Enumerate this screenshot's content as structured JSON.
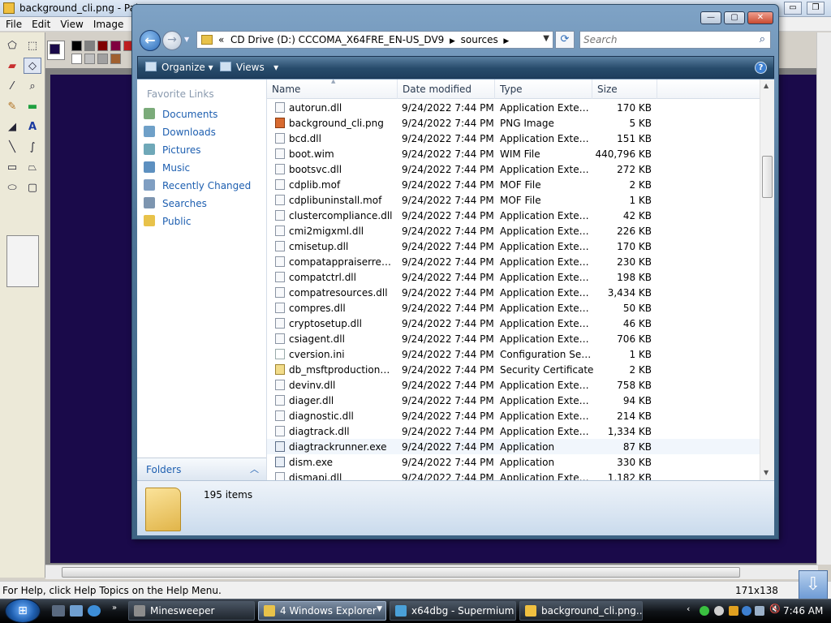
{
  "paint": {
    "title": "background_cli.png - Paint",
    "menu": [
      "File",
      "Edit",
      "View",
      "Image"
    ],
    "status_help": "For Help, click Help Topics on the Help Menu.",
    "status_coords": "171x138"
  },
  "explorer": {
    "caption_buttons": {
      "minimize": "—",
      "maximize": "▢",
      "close": "✕"
    },
    "address": {
      "prefix": "«",
      "crumbs": [
        "CD Drive (D:) CCCOMA_X64FRE_EN-US_DV9",
        "sources"
      ]
    },
    "search_placeholder": "Search",
    "commands": {
      "organize": "Organize",
      "views": "Views"
    },
    "favorite_links_header": "Favorite Links",
    "favorite_links": [
      "Documents",
      "Downloads",
      "Pictures",
      "Music",
      "Recently Changed",
      "Searches",
      "Public"
    ],
    "folders_label": "Folders",
    "columns": {
      "name": "Name",
      "date": "Date modified",
      "type": "Type",
      "size": "Size"
    },
    "files": [
      {
        "name": "autorun.dll",
        "date": "9/24/2022 7:44 PM",
        "type": "Application Extens...",
        "size": "170 KB",
        "icon": "dll"
      },
      {
        "name": "background_cli.png",
        "date": "9/24/2022 7:44 PM",
        "type": "PNG Image",
        "size": "5 KB",
        "icon": "png"
      },
      {
        "name": "bcd.dll",
        "date": "9/24/2022 7:44 PM",
        "type": "Application Extens...",
        "size": "151 KB",
        "icon": "dll"
      },
      {
        "name": "boot.wim",
        "date": "9/24/2022 7:44 PM",
        "type": "WIM File",
        "size": "440,796 KB",
        "icon": "file"
      },
      {
        "name": "bootsvc.dll",
        "date": "9/24/2022 7:44 PM",
        "type": "Application Extens...",
        "size": "272 KB",
        "icon": "dll"
      },
      {
        "name": "cdplib.mof",
        "date": "9/24/2022 7:44 PM",
        "type": "MOF File",
        "size": "2 KB",
        "icon": "file"
      },
      {
        "name": "cdplibuninstall.mof",
        "date": "9/24/2022 7:44 PM",
        "type": "MOF File",
        "size": "1 KB",
        "icon": "file"
      },
      {
        "name": "clustercompliance.dll",
        "date": "9/24/2022 7:44 PM",
        "type": "Application Extens...",
        "size": "42 KB",
        "icon": "dll"
      },
      {
        "name": "cmi2migxml.dll",
        "date": "9/24/2022 7:44 PM",
        "type": "Application Extens...",
        "size": "226 KB",
        "icon": "dll"
      },
      {
        "name": "cmisetup.dll",
        "date": "9/24/2022 7:44 PM",
        "type": "Application Extens...",
        "size": "170 KB",
        "icon": "dll"
      },
      {
        "name": "compatappraiserresou...",
        "date": "9/24/2022 7:44 PM",
        "type": "Application Extens...",
        "size": "230 KB",
        "icon": "dll"
      },
      {
        "name": "compatctrl.dll",
        "date": "9/24/2022 7:44 PM",
        "type": "Application Extens...",
        "size": "198 KB",
        "icon": "dll"
      },
      {
        "name": "compatresources.dll",
        "date": "9/24/2022 7:44 PM",
        "type": "Application Extens...",
        "size": "3,434 KB",
        "icon": "dll"
      },
      {
        "name": "compres.dll",
        "date": "9/24/2022 7:44 PM",
        "type": "Application Extens...",
        "size": "50 KB",
        "icon": "dll"
      },
      {
        "name": "cryptosetup.dll",
        "date": "9/24/2022 7:44 PM",
        "type": "Application Extens...",
        "size": "46 KB",
        "icon": "dll"
      },
      {
        "name": "csiagent.dll",
        "date": "9/24/2022 7:44 PM",
        "type": "Application Extens...",
        "size": "706 KB",
        "icon": "dll"
      },
      {
        "name": "cversion.ini",
        "date": "9/24/2022 7:44 PM",
        "type": "Configuration Sett...",
        "size": "1 KB",
        "icon": "ini"
      },
      {
        "name": "db_msftproductionwin...",
        "date": "9/24/2022 7:44 PM",
        "type": "Security Certificate",
        "size": "2 KB",
        "icon": "cert"
      },
      {
        "name": "devinv.dll",
        "date": "9/24/2022 7:44 PM",
        "type": "Application Extens...",
        "size": "758 KB",
        "icon": "dll"
      },
      {
        "name": "diager.dll",
        "date": "9/24/2022 7:44 PM",
        "type": "Application Extens...",
        "size": "94 KB",
        "icon": "dll"
      },
      {
        "name": "diagnostic.dll",
        "date": "9/24/2022 7:44 PM",
        "type": "Application Extens...",
        "size": "214 KB",
        "icon": "dll"
      },
      {
        "name": "diagtrack.dll",
        "date": "9/24/2022 7:44 PM",
        "type": "Application Extens...",
        "size": "1,334 KB",
        "icon": "dll"
      },
      {
        "name": "diagtrackrunner.exe",
        "date": "9/24/2022 7:44 PM",
        "type": "Application",
        "size": "87 KB",
        "icon": "exe"
      },
      {
        "name": "dism.exe",
        "date": "9/24/2022 7:44 PM",
        "type": "Application",
        "size": "330 KB",
        "icon": "exe"
      },
      {
        "name": "dismapi.dll",
        "date": "9/24/2022 7:44 PM",
        "type": "Application Extens...",
        "size": "1,182 KB",
        "icon": "dll"
      }
    ],
    "hover_row": 22,
    "item_count": "195 items"
  },
  "taskbar": {
    "tasks": [
      {
        "label": "Minesweeper",
        "active": false,
        "color": "#8c8c8c"
      },
      {
        "label": "4 Windows Explorer",
        "active": true,
        "color": "#e8c24a"
      },
      {
        "label": "x64dbg - Supermium",
        "active": false,
        "color": "#4aa0d8"
      },
      {
        "label": "background_cli.png...",
        "active": false,
        "color": "#f0c040"
      }
    ],
    "clock": "7:46 AM"
  }
}
